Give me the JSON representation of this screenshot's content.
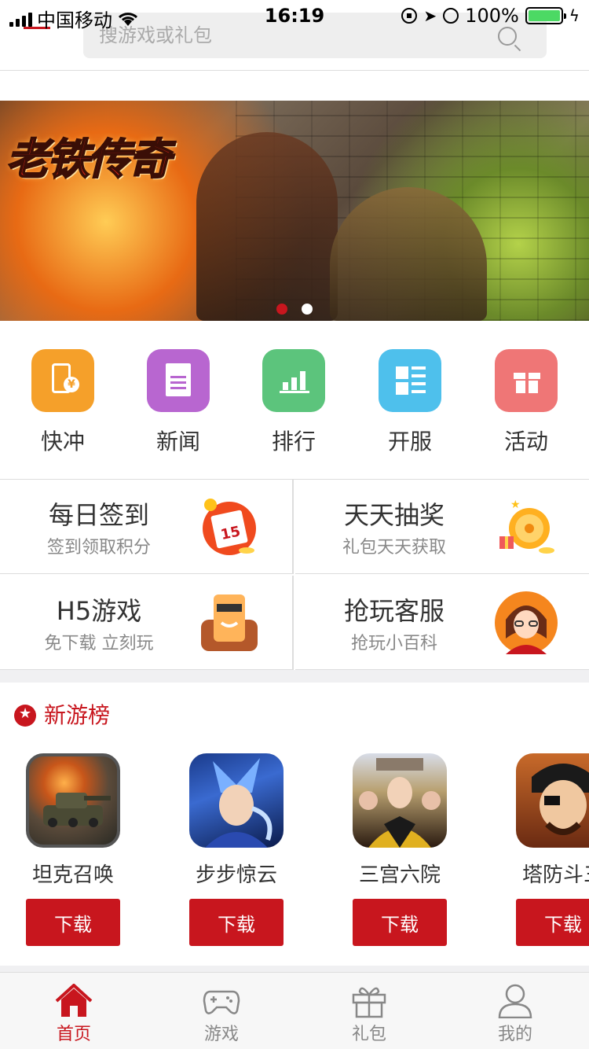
{
  "status_bar": {
    "carrier": "中国移动",
    "time": "16:19",
    "battery": "100%"
  },
  "header": {
    "search_placeholder": "搜游戏或礼包"
  },
  "banner": {
    "title": "老铁传奇",
    "slide_count": 2,
    "active_slide": 1
  },
  "quick_nav": [
    {
      "label": "快冲",
      "icon": "recharge-phone-icon",
      "color": "#f5a02a"
    },
    {
      "label": "新闻",
      "icon": "news-document-icon",
      "color": "#b866d0"
    },
    {
      "label": "排行",
      "icon": "ranking-bar-chart-icon",
      "color": "#5cc47c"
    },
    {
      "label": "开服",
      "icon": "server-grid-icon",
      "color": "#4ec0ec"
    },
    {
      "label": "活动",
      "icon": "activity-gift-icon",
      "color": "#ef7676"
    }
  ],
  "features": [
    {
      "title": "每日签到",
      "subtitle": "签到领取积分",
      "icon": "calendar-icon"
    },
    {
      "title": "天天抽奖",
      "subtitle": "礼包天天获取",
      "icon": "lottery-wheel-icon"
    },
    {
      "title": "H5游戏",
      "subtitle": "免下载 立刻玩",
      "icon": "h5-phone-character-icon"
    },
    {
      "title": "抢玩客服",
      "subtitle": "抢玩小百科",
      "icon": "customer-service-avatar-icon"
    }
  ],
  "calendar_badge": "15",
  "new_games": {
    "title": "新游榜",
    "download_label": "下载",
    "items": [
      {
        "name": "坦克召唤"
      },
      {
        "name": "步步惊云"
      },
      {
        "name": "三宫六院"
      },
      {
        "name": "塔防斗三"
      }
    ]
  },
  "tabbar": [
    {
      "label": "首页",
      "icon": "home-icon",
      "active": true
    },
    {
      "label": "游戏",
      "icon": "gamepad-icon",
      "active": false
    },
    {
      "label": "礼包",
      "icon": "gift-icon",
      "active": false
    },
    {
      "label": "我的",
      "icon": "user-icon",
      "active": false
    }
  ],
  "colors": {
    "accent": "#c8161e"
  }
}
